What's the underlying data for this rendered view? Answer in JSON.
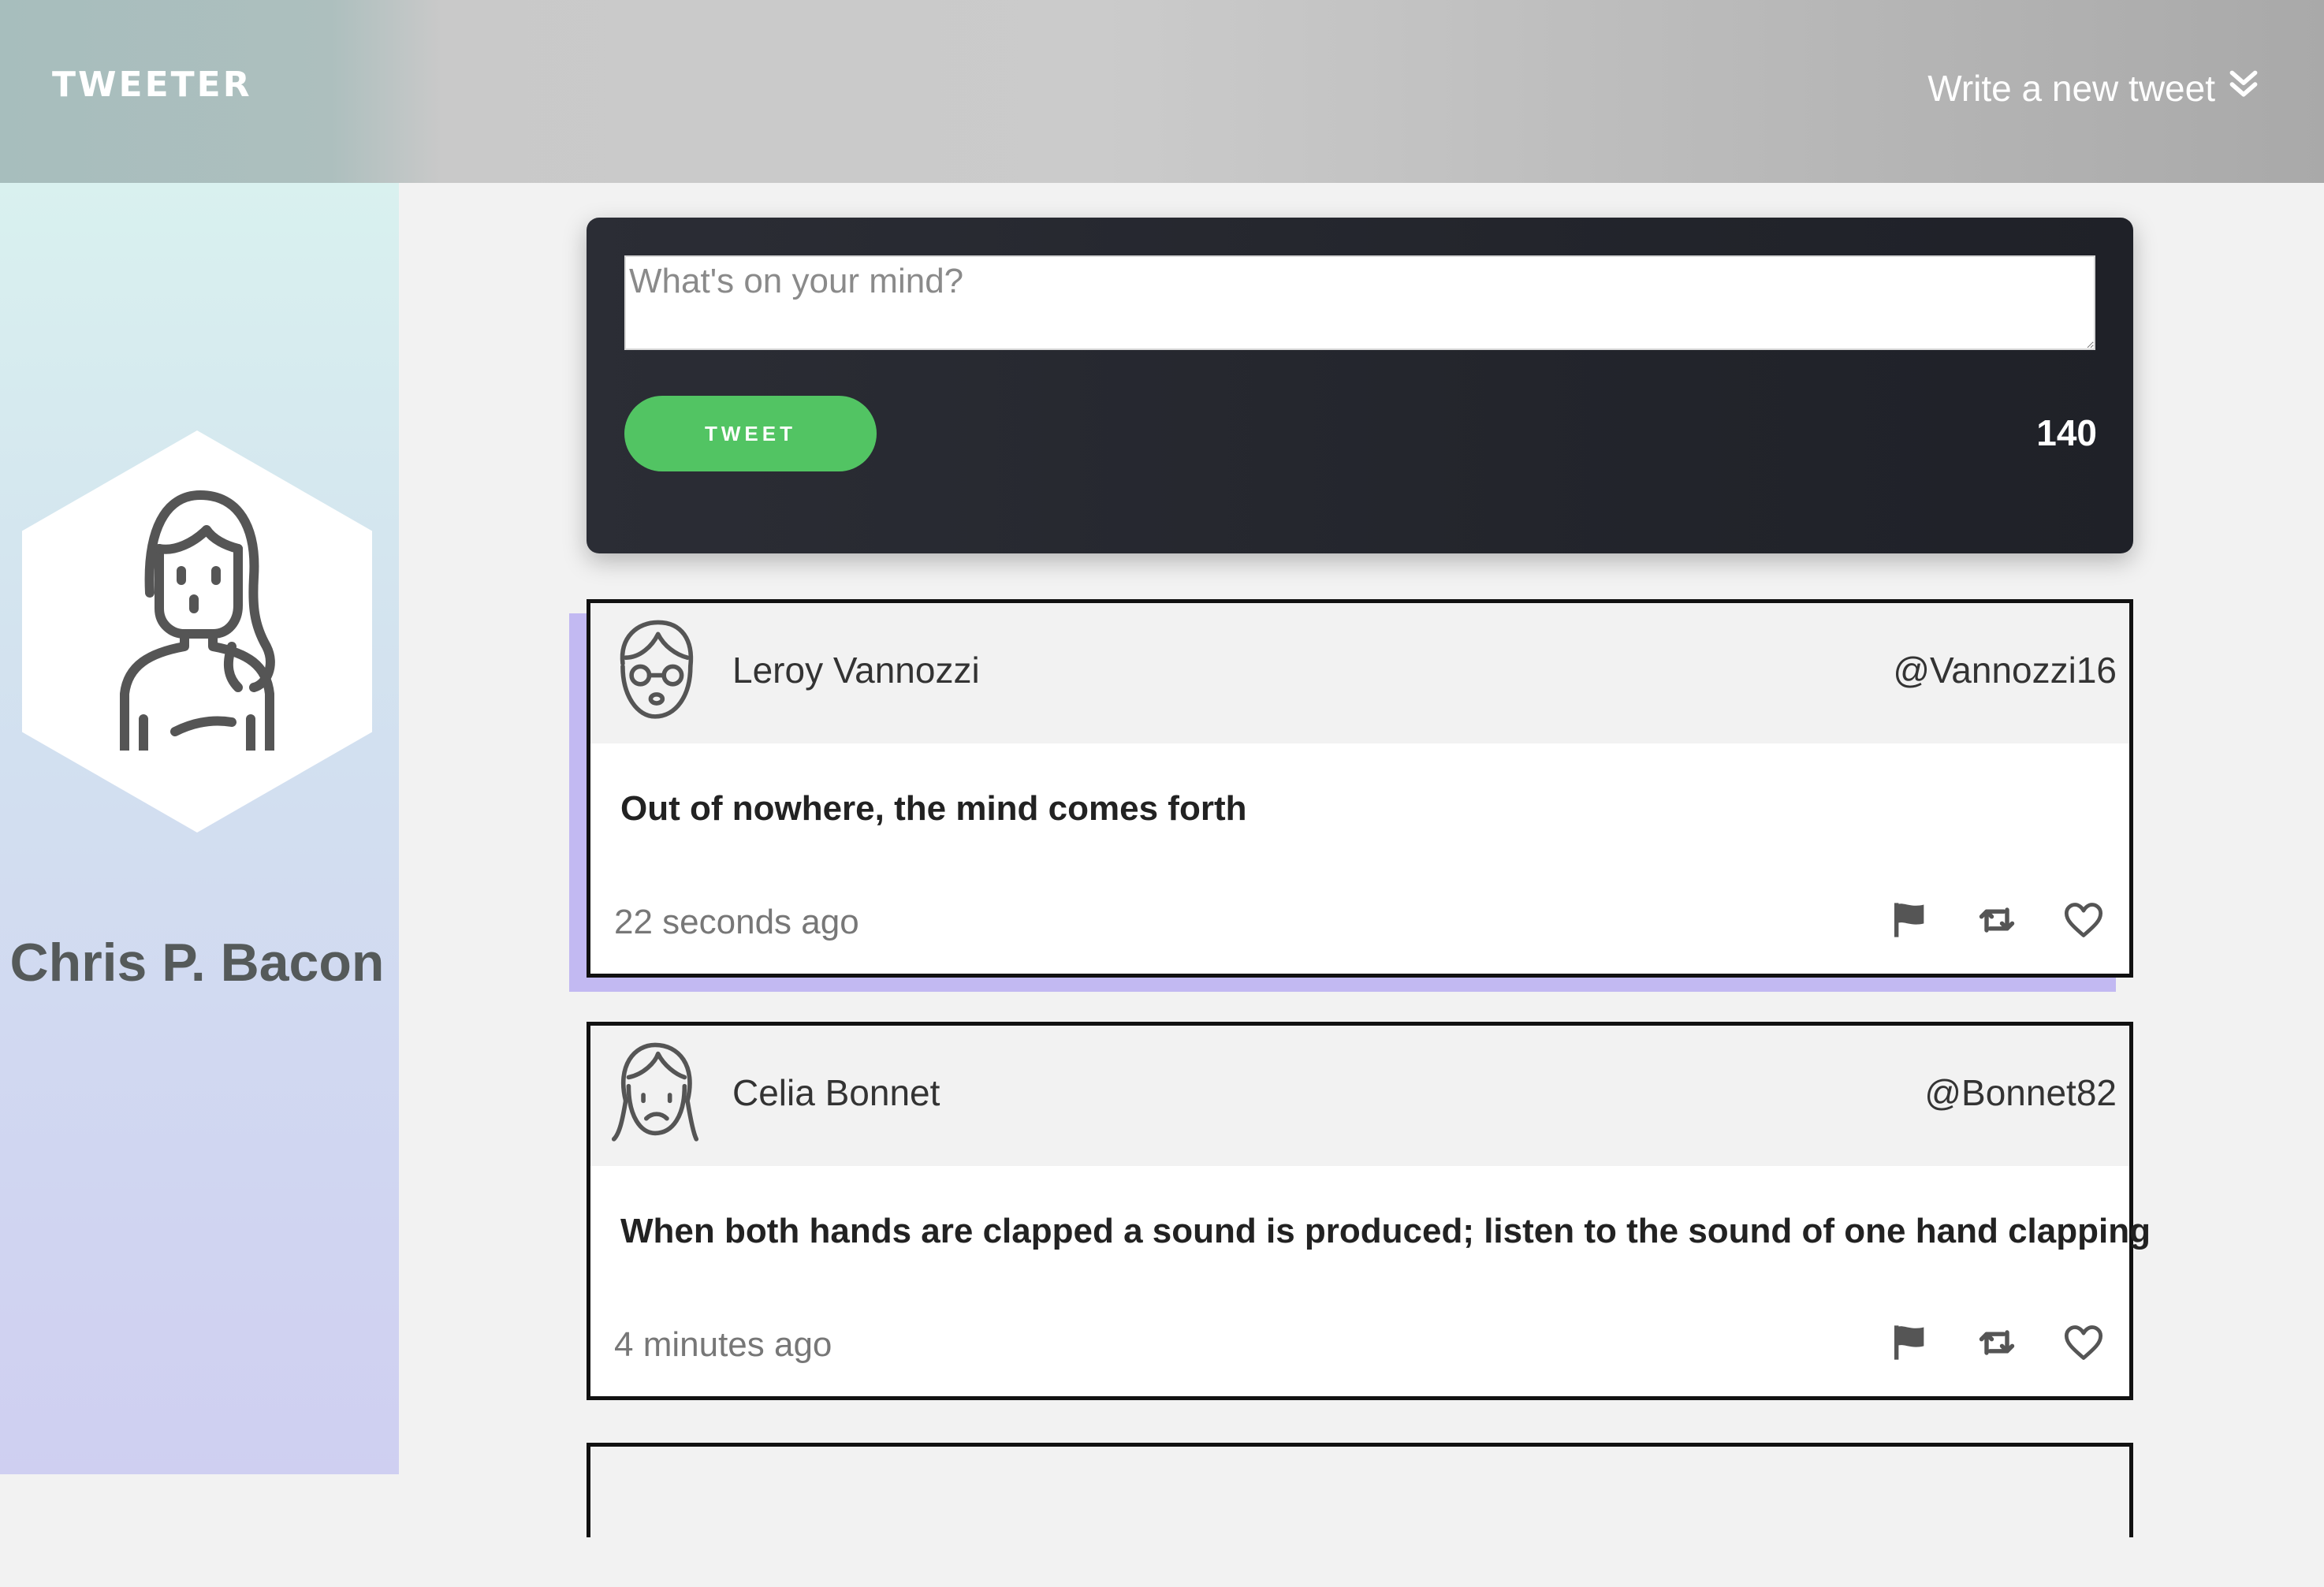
{
  "nav": {
    "brand": "TWEETER",
    "compose_label": "Write a new tweet",
    "compose_icon": "double-chevron-down-icon"
  },
  "profile": {
    "name": "Chris P. Bacon",
    "avatar_icon": "user-avatar-icon"
  },
  "composer": {
    "placeholder": "What's on your mind?",
    "value": "",
    "button_label": "TWEET",
    "counter": "140"
  },
  "tweets": [
    {
      "author": "Leroy Vannozzi",
      "handle": "@Vannozzi16",
      "content": "Out of nowhere, the mind comes forth",
      "time": "22 seconds ago",
      "avatar_icon": "glasses-avatar-icon"
    },
    {
      "author": "Celia Bonnet",
      "handle": "@Bonnet82",
      "content": "When both hands are clapped a sound is produced; listen to the sound of one hand clapping",
      "time": "4 minutes ago",
      "avatar_icon": "woman-avatar-icon"
    }
  ],
  "actions": {
    "flag_icon": "flag-icon",
    "retweet_icon": "retweet-icon",
    "like_icon": "heart-icon"
  },
  "colors": {
    "accent_green": "#52c463",
    "highlight_purple": "#c2b9f2",
    "composer_bg": "#23252c"
  }
}
